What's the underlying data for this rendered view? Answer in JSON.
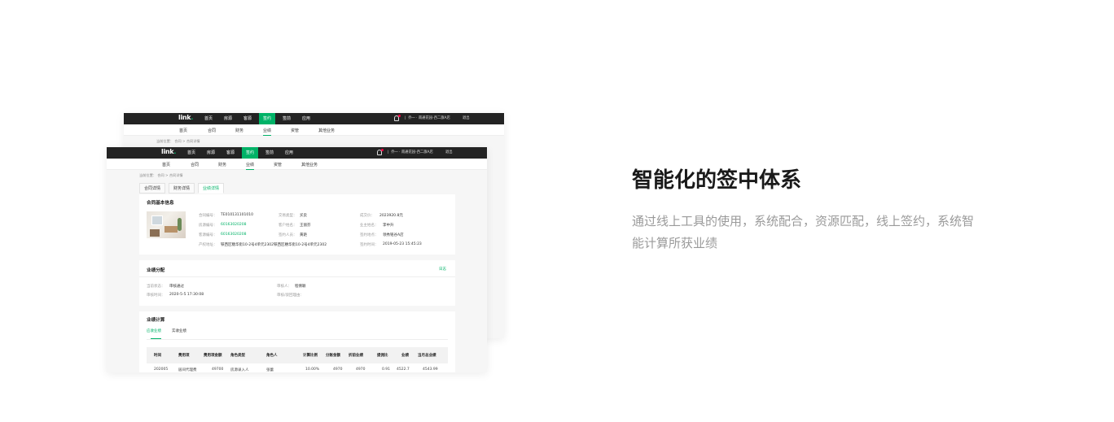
{
  "feature": {
    "title": "智能化的签中体系",
    "description": "通过线上工具的使用，系统配合，资源匹配，线上签约，系统智能计算所获业绩"
  },
  "app": {
    "logo": "link",
    "top_nav": [
      "首页",
      "房源",
      "客源",
      "签约",
      "签前",
      "应用"
    ],
    "active_top": "签约",
    "user_info": "乔一 · 南通花园-西二旗A店",
    "logout": "退出",
    "sub_nav": [
      "首页",
      "合同",
      "财务",
      "业绩",
      "资管",
      "其他业务"
    ],
    "active_sub": "业绩",
    "breadcrumb": "当前位置： 合同 >  合同详情",
    "tabs": [
      "合同详情",
      "财务详情",
      "业绩详情"
    ],
    "active_tab": "业绩详情"
  },
  "contract": {
    "title": "合同基本信息",
    "fields": {
      "contract_no_label": "合同编号：",
      "contract_no": "TE010131101010",
      "deal_type_label": "交易类型：",
      "deal_type": "买卖",
      "deal_price_label": "成交价：",
      "deal_price": "2023920.8元",
      "house_no_label": "房源编号：",
      "house_no": "60163020208",
      "customer_label": "客户姓名：",
      "customer": "王丽芬",
      "owner_label": "业主姓名：",
      "owner": "李中升",
      "client_no_label": "客源编号：",
      "client_no": "60163020208",
      "signer_label": "签约人员：",
      "signer": "黄艳",
      "sign_place_label": "签约地点：",
      "sign_place": "领秀铭谷A店",
      "address_label": "产权地址：",
      "address": "铁西区糖华街10-2号4单元2302铁西区穗华街10-2号4单元2302",
      "sign_time_label": "签约时间：",
      "sign_time": "2019-05-23 15:45:23"
    }
  },
  "allocation": {
    "title": "业绩分配",
    "log_link": "日志",
    "status_label": "当前状态：",
    "status": "审核通过",
    "reviewer_label": "审核人：",
    "reviewer": "程倩颖",
    "review_time_label": "审核时间：",
    "review_time": "2020-5-5 17:30:08",
    "review_note_label": "审核/驳回理由：",
    "review_note": ""
  },
  "calc": {
    "title": "业绩计算",
    "tabs": [
      "应收业绩",
      "实收业绩"
    ],
    "active_tab": "应收业绩",
    "columns": [
      "时间",
      "费用项",
      "费用项金额",
      "角色类型",
      "角色人",
      "计算比例",
      "分账金额",
      "折前业绩",
      "提佣比",
      "业绩",
      "当月总业绩"
    ],
    "rows": [
      [
        "202005",
        "居间代理费",
        "49700",
        "房源录入人",
        "张蕾",
        "10.00%",
        "4970",
        "4970",
        "0.91",
        "4522.7",
        "4543.99"
      ]
    ]
  },
  "colors": {
    "accent": "#00b267",
    "topbar": "#232323",
    "heading": "#1a1a1a",
    "description": "#9a9a9a"
  }
}
